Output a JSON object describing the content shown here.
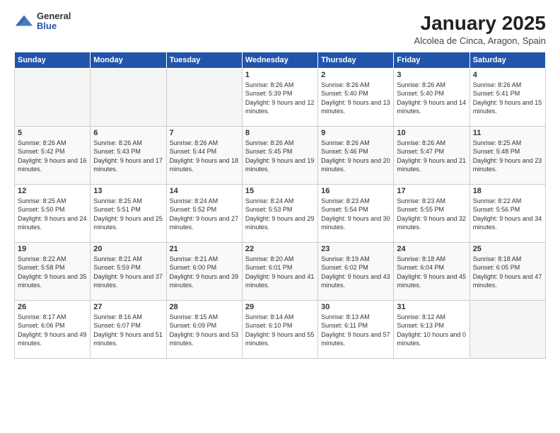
{
  "logo": {
    "general": "General",
    "blue": "Blue"
  },
  "title": "January 2025",
  "subtitle": "Alcolea de Cinca, Aragon, Spain",
  "weekdays": [
    "Sunday",
    "Monday",
    "Tuesday",
    "Wednesday",
    "Thursday",
    "Friday",
    "Saturday"
  ],
  "weeks": [
    [
      {
        "day": "",
        "empty": true
      },
      {
        "day": "",
        "empty": true
      },
      {
        "day": "",
        "empty": true
      },
      {
        "day": "1",
        "sunrise": "8:26 AM",
        "sunset": "5:39 PM",
        "daylight": "9 hours and 12 minutes."
      },
      {
        "day": "2",
        "sunrise": "8:26 AM",
        "sunset": "5:40 PM",
        "daylight": "9 hours and 13 minutes."
      },
      {
        "day": "3",
        "sunrise": "8:26 AM",
        "sunset": "5:40 PM",
        "daylight": "9 hours and 14 minutes."
      },
      {
        "day": "4",
        "sunrise": "8:26 AM",
        "sunset": "5:41 PM",
        "daylight": "9 hours and 15 minutes."
      }
    ],
    [
      {
        "day": "5",
        "sunrise": "8:26 AM",
        "sunset": "5:42 PM",
        "daylight": "9 hours and 16 minutes."
      },
      {
        "day": "6",
        "sunrise": "8:26 AM",
        "sunset": "5:43 PM",
        "daylight": "9 hours and 17 minutes."
      },
      {
        "day": "7",
        "sunrise": "8:26 AM",
        "sunset": "5:44 PM",
        "daylight": "9 hours and 18 minutes."
      },
      {
        "day": "8",
        "sunrise": "8:26 AM",
        "sunset": "5:45 PM",
        "daylight": "9 hours and 19 minutes."
      },
      {
        "day": "9",
        "sunrise": "8:26 AM",
        "sunset": "5:46 PM",
        "daylight": "9 hours and 20 minutes."
      },
      {
        "day": "10",
        "sunrise": "8:26 AM",
        "sunset": "5:47 PM",
        "daylight": "9 hours and 21 minutes."
      },
      {
        "day": "11",
        "sunrise": "8:25 AM",
        "sunset": "5:48 PM",
        "daylight": "9 hours and 23 minutes."
      }
    ],
    [
      {
        "day": "12",
        "sunrise": "8:25 AM",
        "sunset": "5:50 PM",
        "daylight": "9 hours and 24 minutes."
      },
      {
        "day": "13",
        "sunrise": "8:25 AM",
        "sunset": "5:51 PM",
        "daylight": "9 hours and 25 minutes."
      },
      {
        "day": "14",
        "sunrise": "8:24 AM",
        "sunset": "5:52 PM",
        "daylight": "9 hours and 27 minutes."
      },
      {
        "day": "15",
        "sunrise": "8:24 AM",
        "sunset": "5:53 PM",
        "daylight": "9 hours and 29 minutes."
      },
      {
        "day": "16",
        "sunrise": "8:23 AM",
        "sunset": "5:54 PM",
        "daylight": "9 hours and 30 minutes."
      },
      {
        "day": "17",
        "sunrise": "8:23 AM",
        "sunset": "5:55 PM",
        "daylight": "9 hours and 32 minutes."
      },
      {
        "day": "18",
        "sunrise": "8:22 AM",
        "sunset": "5:56 PM",
        "daylight": "9 hours and 34 minutes."
      }
    ],
    [
      {
        "day": "19",
        "sunrise": "8:22 AM",
        "sunset": "5:58 PM",
        "daylight": "9 hours and 35 minutes."
      },
      {
        "day": "20",
        "sunrise": "8:21 AM",
        "sunset": "5:59 PM",
        "daylight": "9 hours and 37 minutes."
      },
      {
        "day": "21",
        "sunrise": "8:21 AM",
        "sunset": "6:00 PM",
        "daylight": "9 hours and 39 minutes."
      },
      {
        "day": "22",
        "sunrise": "8:20 AM",
        "sunset": "6:01 PM",
        "daylight": "9 hours and 41 minutes."
      },
      {
        "day": "23",
        "sunrise": "8:19 AM",
        "sunset": "6:02 PM",
        "daylight": "9 hours and 43 minutes."
      },
      {
        "day": "24",
        "sunrise": "8:18 AM",
        "sunset": "6:04 PM",
        "daylight": "9 hours and 45 minutes."
      },
      {
        "day": "25",
        "sunrise": "8:18 AM",
        "sunset": "6:05 PM",
        "daylight": "9 hours and 47 minutes."
      }
    ],
    [
      {
        "day": "26",
        "sunrise": "8:17 AM",
        "sunset": "6:06 PM",
        "daylight": "9 hours and 49 minutes."
      },
      {
        "day": "27",
        "sunrise": "8:16 AM",
        "sunset": "6:07 PM",
        "daylight": "9 hours and 51 minutes."
      },
      {
        "day": "28",
        "sunrise": "8:15 AM",
        "sunset": "6:09 PM",
        "daylight": "9 hours and 53 minutes."
      },
      {
        "day": "29",
        "sunrise": "8:14 AM",
        "sunset": "6:10 PM",
        "daylight": "9 hours and 55 minutes."
      },
      {
        "day": "30",
        "sunrise": "8:13 AM",
        "sunset": "6:11 PM",
        "daylight": "9 hours and 57 minutes."
      },
      {
        "day": "31",
        "sunrise": "8:12 AM",
        "sunset": "6:13 PM",
        "daylight": "10 hours and 0 minutes."
      },
      {
        "day": "",
        "empty": true
      }
    ]
  ]
}
